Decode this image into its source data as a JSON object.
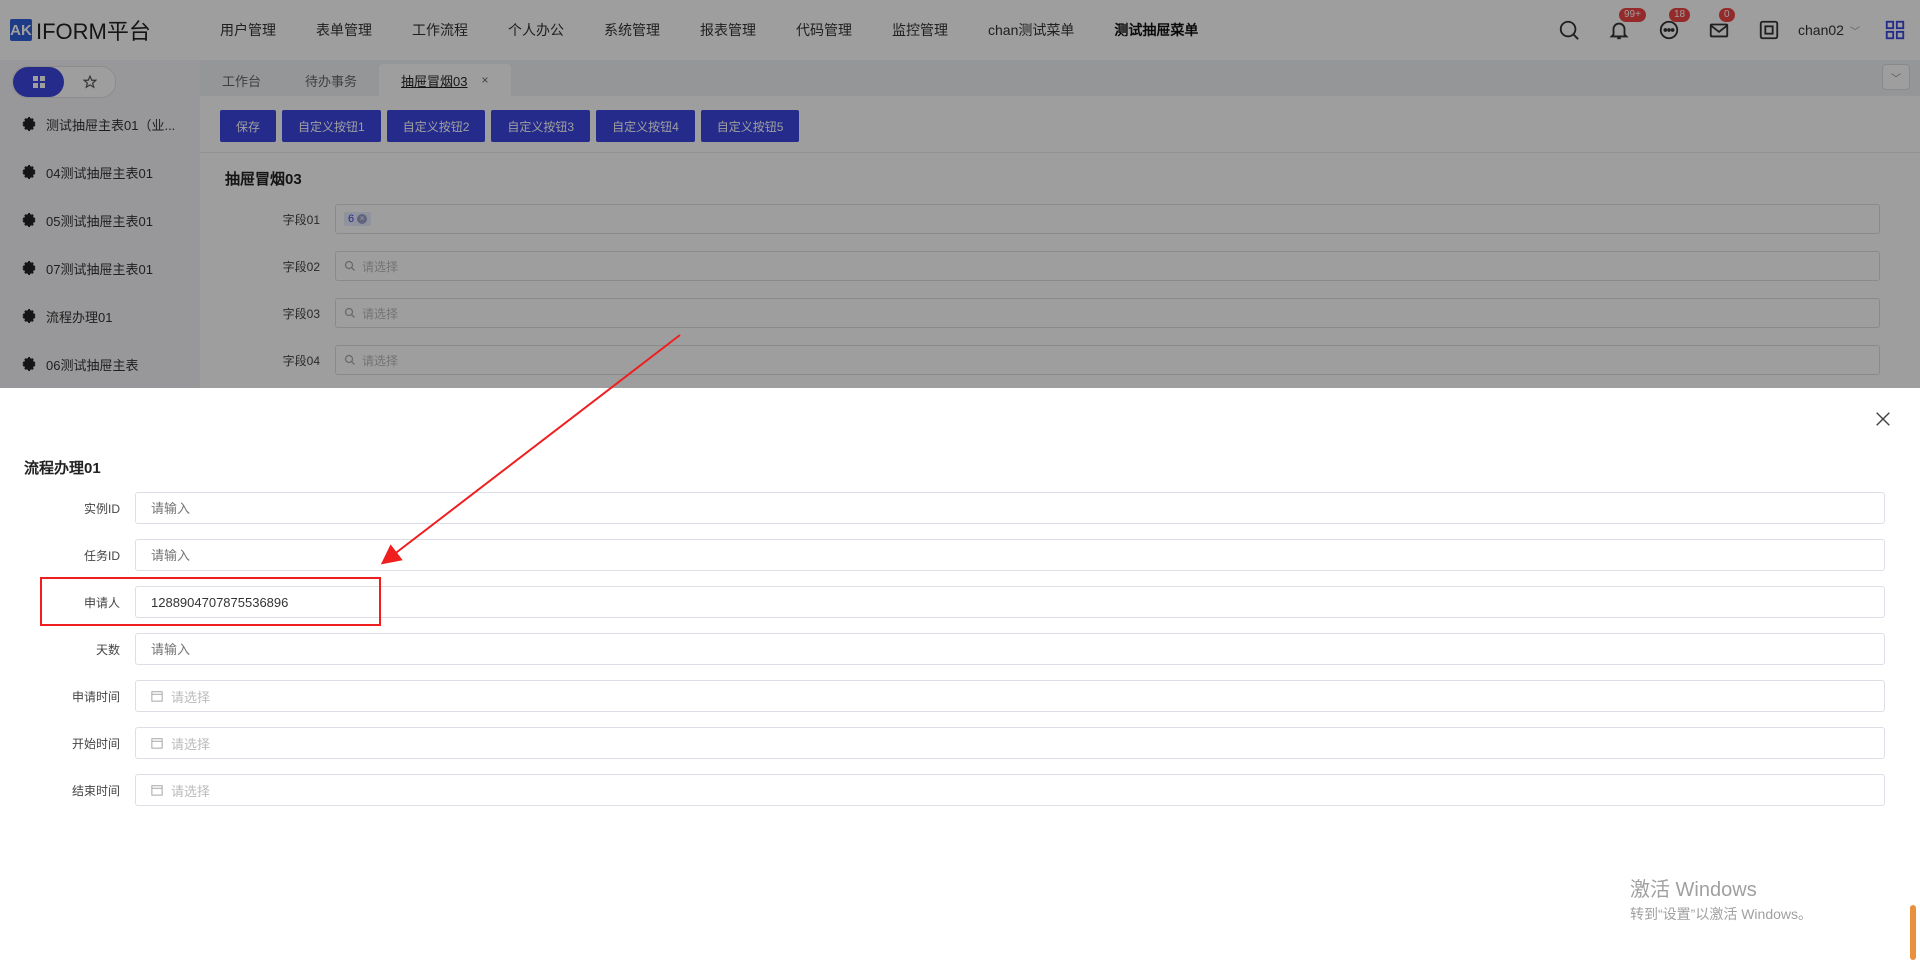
{
  "app": {
    "logo_mark": "AK",
    "logo_text": "IFORM平台"
  },
  "menu": [
    "用户管理",
    "表单管理",
    "工作流程",
    "个人办公",
    "系统管理",
    "报表管理",
    "代码管理",
    "监控管理",
    "chan测试菜单",
    "测试抽屉菜单"
  ],
  "header": {
    "notifications_badge": "99+",
    "messages_badge": "18",
    "mail_badge": "0",
    "user": "chan02"
  },
  "sidebar": {
    "items": [
      "测试抽屉主表01（业...",
      "04测试抽屉主表01",
      "05测试抽屉主表01",
      "07测试抽屉主表01",
      "流程办理01",
      "06测试抽屉主表"
    ]
  },
  "tabs": [
    "工作台",
    "待办事务",
    "抽屉冒烟03"
  ],
  "tab_close": "×",
  "toolbar": [
    "保存",
    "自定义按钮1",
    "自定义按钮2",
    "自定义按钮3",
    "自定义按钮4",
    "自定义按钮5"
  ],
  "main_form": {
    "title": "抽屉冒烟03",
    "field1_label": "字段01",
    "field1_tag": "6",
    "field2_label": "字段02",
    "field3_label": "字段03",
    "field4_label": "字段04",
    "select_placeholder": "请选择"
  },
  "drawer": {
    "title": "流程办理01",
    "fields": {
      "instance_id_label": "实例ID",
      "instance_id_placeholder": "请输入",
      "task_id_label": "任务ID",
      "task_id_placeholder": "请输入",
      "applicant_label": "申请人",
      "applicant_value": "1288904707875536896",
      "days_label": "天数",
      "days_placeholder": "请输入",
      "apply_time_label": "申请时间",
      "apply_time_placeholder": "请选择",
      "start_time_label": "开始时间",
      "start_time_placeholder": "请选择",
      "end_time_label": "结束时间",
      "end_time_placeholder": "请选择"
    }
  },
  "watermark": {
    "line1": "激活 Windows",
    "line2": "转到“设置”以激活 Windows。"
  },
  "colors": {
    "primary": "#3d46e0",
    "badge": "#f04545",
    "highlight": "#f01e1e"
  }
}
